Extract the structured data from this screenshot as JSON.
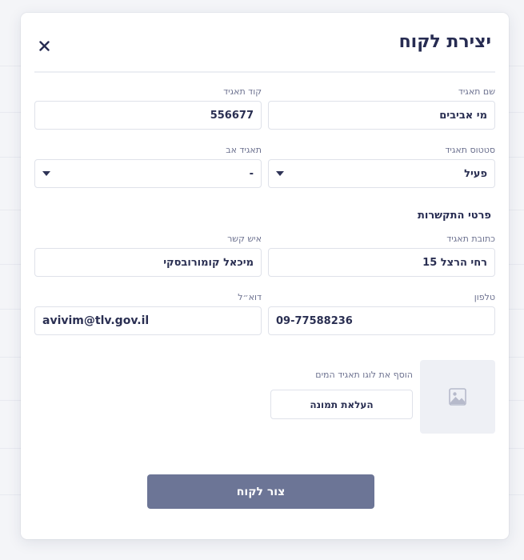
{
  "modal": {
    "title": "יצירת לקוח",
    "close_icon": "close-icon"
  },
  "form": {
    "name": {
      "label": "שם תאגיד",
      "value": "מי אביבים"
    },
    "code": {
      "label": "קוד תאגיד",
      "value": "556677"
    },
    "status": {
      "label": "סטטוס תאגיד",
      "value": "פעיל"
    },
    "parent": {
      "label": "תאגיד אב",
      "value": "-"
    }
  },
  "contact": {
    "section_title": "פרטי התקשרות",
    "address": {
      "label": "כתובת תאגיד",
      "value": "רחי הרצל 15"
    },
    "person": {
      "label": "איש קשר",
      "value": "מיכאל קומורובסקי"
    },
    "phone": {
      "label": "טלפון",
      "value": "09-77588236"
    },
    "email": {
      "label": "דוא״ל",
      "value": "avivim@tlv.gov.il"
    }
  },
  "logo": {
    "hint": "הוסף את לוגו תאגיד המים",
    "upload_label": "העלאת תמונה",
    "placeholder_icon": "image-icon"
  },
  "actions": {
    "submit_label": "צור לקוח",
    "submit_color": "#6c7596"
  }
}
